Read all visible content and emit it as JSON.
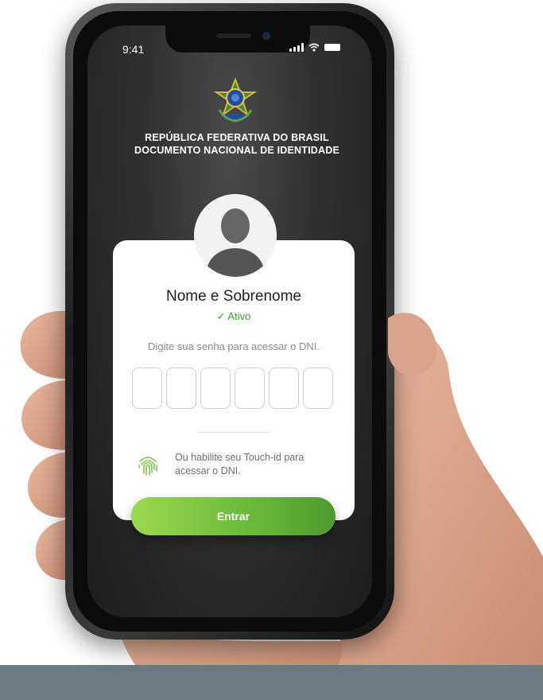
{
  "status_bar": {
    "time": "9:41"
  },
  "header": {
    "line1": "REPÚBLICA FEDERATIVA DO BRASIL",
    "line2": "DOCUMENTO NACIONAL DE IDENTIDADE"
  },
  "card": {
    "name": "Nome e Sobrenome",
    "status": "✓ Ativo",
    "prompt": "Digite sua senha para acessar o DNI.",
    "pin_length": 6,
    "touch_id_line1": "Ou habilite seu Touch-id para",
    "touch_id_line2": "acessar o DNI."
  },
  "button": {
    "label": "Entrar"
  },
  "colors": {
    "accent_green": "#6cbb3d",
    "status_green": "#39a12f",
    "screen_bg": "#2f2f2f"
  },
  "icons": [
    "brazil-coat-of-arms-icon",
    "avatar-silhouette-icon",
    "fingerprint-icon",
    "signal-icon",
    "wifi-icon",
    "battery-icon"
  ]
}
